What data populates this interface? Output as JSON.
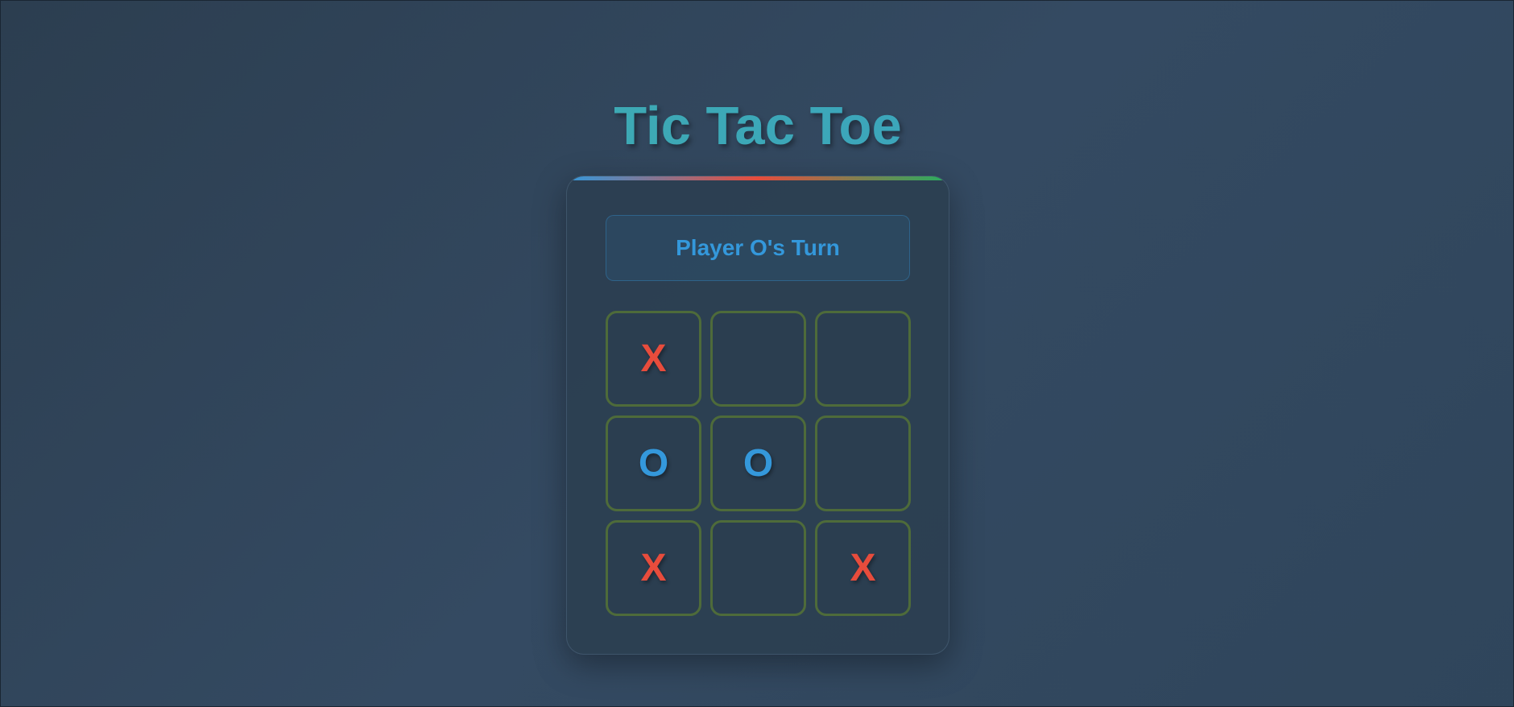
{
  "game": {
    "title": "Tic Tac Toe",
    "status": "Player O's Turn",
    "board": [
      "X",
      "",
      "",
      "O",
      "O",
      "",
      "X",
      "",
      "X"
    ]
  },
  "colors": {
    "x": "#e74c3c",
    "o": "#3498db",
    "cell_border": "#4e6b3a",
    "title_start": "#3fb1a6",
    "title_end": "#3a9ec9"
  }
}
